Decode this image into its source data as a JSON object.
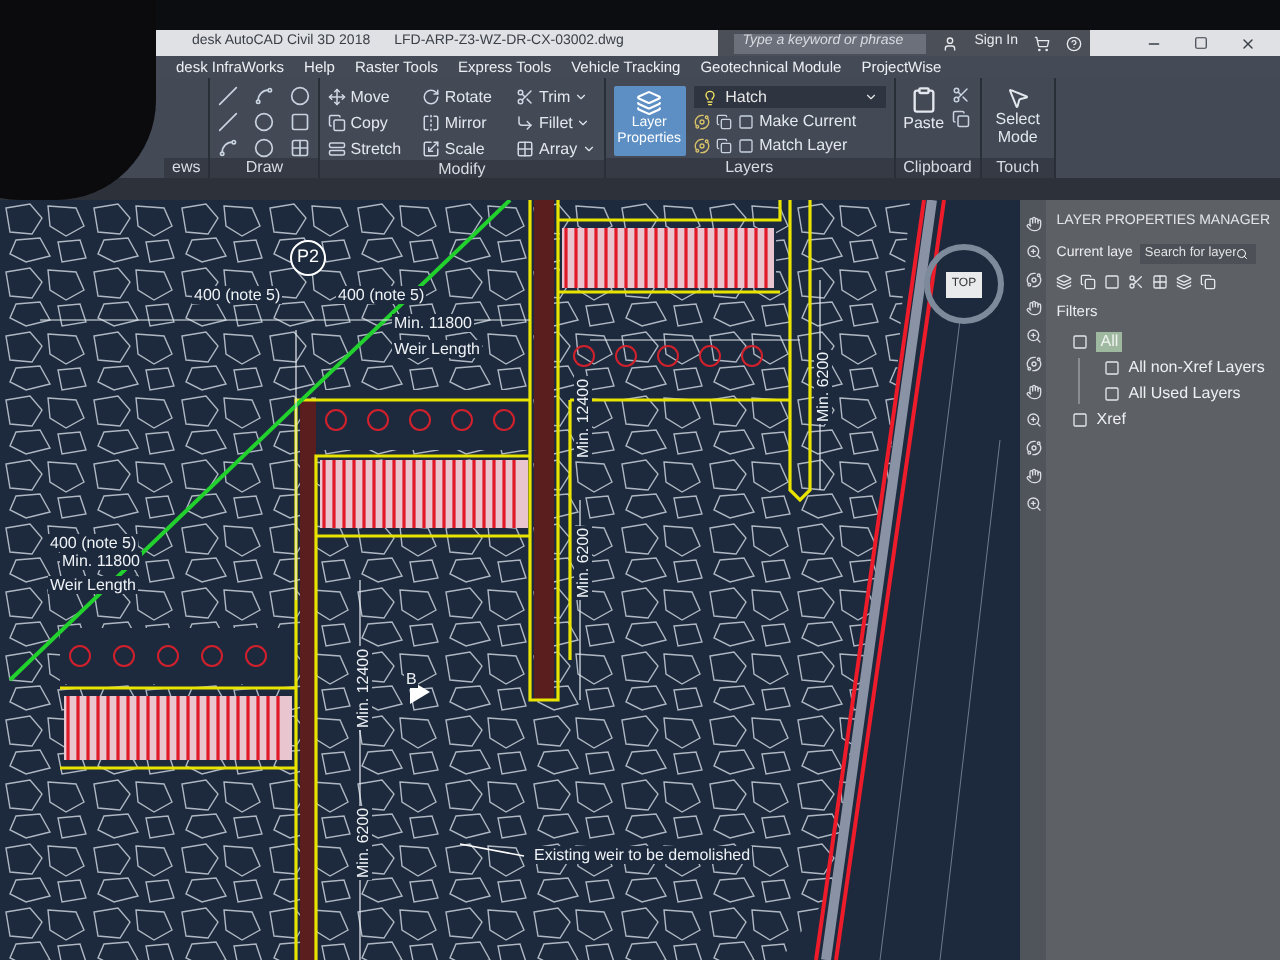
{
  "title_bar": {
    "app": "desk AutoCAD Civil 3D 2018",
    "file": "LFD-ARP-Z3-WZ-DR-CX-03002.dwg",
    "search": {
      "placeholder": "Type a keyword or phrase"
    },
    "sign_in": "Sign In"
  },
  "menu": [
    {
      "label": "desk InfraWorks"
    },
    {
      "label": "Help"
    },
    {
      "label": "Raster Tools"
    },
    {
      "label": "Express Tools"
    },
    {
      "label": "Vehicle Tracking"
    },
    {
      "label": "Geotechnical Module"
    },
    {
      "label": "ProjectWise"
    }
  ],
  "ribbon": {
    "panels": [
      {
        "kind": "stub",
        "title": "ews"
      },
      {
        "kind": "draw",
        "title": "Draw"
      },
      {
        "kind": "modify",
        "title": "Modify",
        "tools": [
          "Move",
          "Rotate",
          "Trim",
          "Copy",
          "Mirror",
          "Fillet",
          "Stretch",
          "Scale",
          "Array"
        ]
      },
      {
        "kind": "layers",
        "title": "Layers",
        "big": "Layer Properties",
        "layer": "Hatch",
        "tools": [
          "Make Current",
          "Match Layer"
        ]
      },
      {
        "kind": "clipboard",
        "title": "Clipboard",
        "big": "Paste"
      },
      {
        "kind": "touch",
        "title": "Touch",
        "big": "Select Mode"
      }
    ]
  },
  "drawing": {
    "labels": [
      {
        "kind": "tag",
        "text": "P2"
      },
      {
        "kind": "text",
        "text": "400 (note 5)"
      },
      {
        "kind": "text",
        "text": "400 (note 5)"
      },
      {
        "kind": "text",
        "text": "Min. 11800"
      },
      {
        "kind": "text",
        "text": "Weir Length"
      },
      {
        "kind": "text",
        "text": "400 (note 5)"
      },
      {
        "kind": "text",
        "text": "Min. 11800"
      },
      {
        "kind": "text",
        "text": "Weir Length"
      },
      {
        "kind": "vertical",
        "text": "Min. 12400"
      },
      {
        "kind": "vertical",
        "text": "Min. 6200"
      },
      {
        "kind": "vertical",
        "text": "Min. 6200"
      },
      {
        "kind": "vertical",
        "text": "Min. 12400"
      },
      {
        "kind": "vertical",
        "text": "Min. 6200"
      },
      {
        "kind": "text",
        "text": "B"
      },
      {
        "kind": "text",
        "text": "Existing weir to be demolished"
      }
    ],
    "viewcube": "TOP"
  },
  "layer_manager": {
    "title": "LAYER PROPERTIES MANAGER",
    "current": "Current laye",
    "search": {
      "placeholder": "Search for layer"
    },
    "filters_heading": "Filters",
    "tree": [
      {
        "label": "All",
        "selected": true,
        "children": [
          {
            "label": "All non-Xref Layers",
            "selected": false
          },
          {
            "label": "All Used Layers",
            "selected": false
          }
        ]
      },
      {
        "label": "Xref",
        "selected": false
      }
    ]
  }
}
